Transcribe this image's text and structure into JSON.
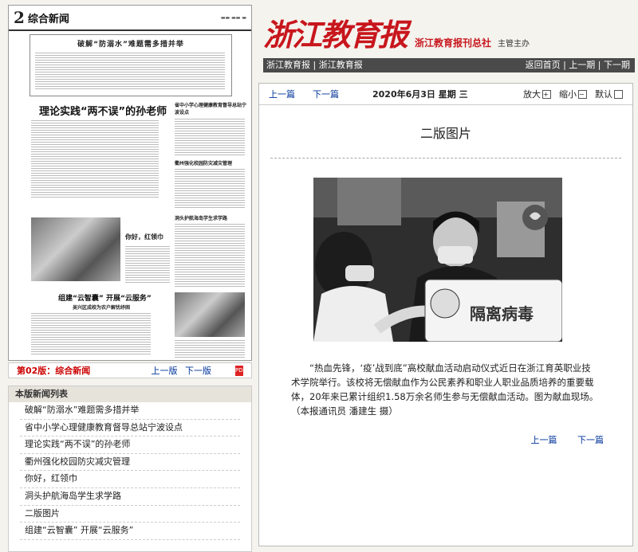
{
  "thumbnail": {
    "page_num": "2",
    "page_name": "综合新闻",
    "headline_top": "破解“防溺水”难题需多措并举",
    "headline_left": "理论实践“两不误”的孙老师",
    "col_title_1": "省中小学心理健康教育督导总站宁波设点",
    "col_title_2": "衢州强化校园防灾减灾管理",
    "col_title_3": "洞头护航海岛学生求学路",
    "photo_caption": "你好，红领巾",
    "bottom_headline": "组建“云智囊” 开展“云服务”",
    "bottom_sub": "吴兴区成校为农户解忧纾困"
  },
  "page_bar": {
    "current": "第02版：综合新闻",
    "prev": "上一版",
    "next": "下一版",
    "pdf": "PDF"
  },
  "news_list": {
    "title": "本版新闻列表",
    "items": [
      "破解“防溺水”难题需多措并举",
      "省中小学心理健康教育督导总站宁波设点",
      "理论实践“两不误”的孙老师",
      "衢州强化校园防灾减灾管理",
      "你好，红领巾",
      "洞头护航海岛学生求学路",
      "二版图片",
      "组建“云智囊” 开展“云服务”"
    ]
  },
  "brand": {
    "logo": "浙江教育报",
    "org": "浙江教育报刊总社",
    "sub": "主管主办"
  },
  "topnav": {
    "left": "浙江教育报 | 浙江教育报",
    "right": "返回首页 | 上一期 | 下一期"
  },
  "toolbar": {
    "prev": "上一篇",
    "next": "下一篇",
    "date": "2020年6月3日 星期 三",
    "zoom_in": "放大",
    "zoom_out": "缩小",
    "default": "默认"
  },
  "article": {
    "title": "二版图片",
    "sign_text": "隔离病毒",
    "body": "“热血先锋，‘疫’战到底”高校献血活动启动仪式近日在浙江育英职业技术学院举行。该校将无偿献血作为公民素养和职业人职业品质培养的重要载体，20年来已累计组织1.58万余名师生参与无偿献血活动。图为献血现场。（本报通讯员 潘建生 摄）",
    "prev": "上一篇",
    "next": "下一篇"
  }
}
